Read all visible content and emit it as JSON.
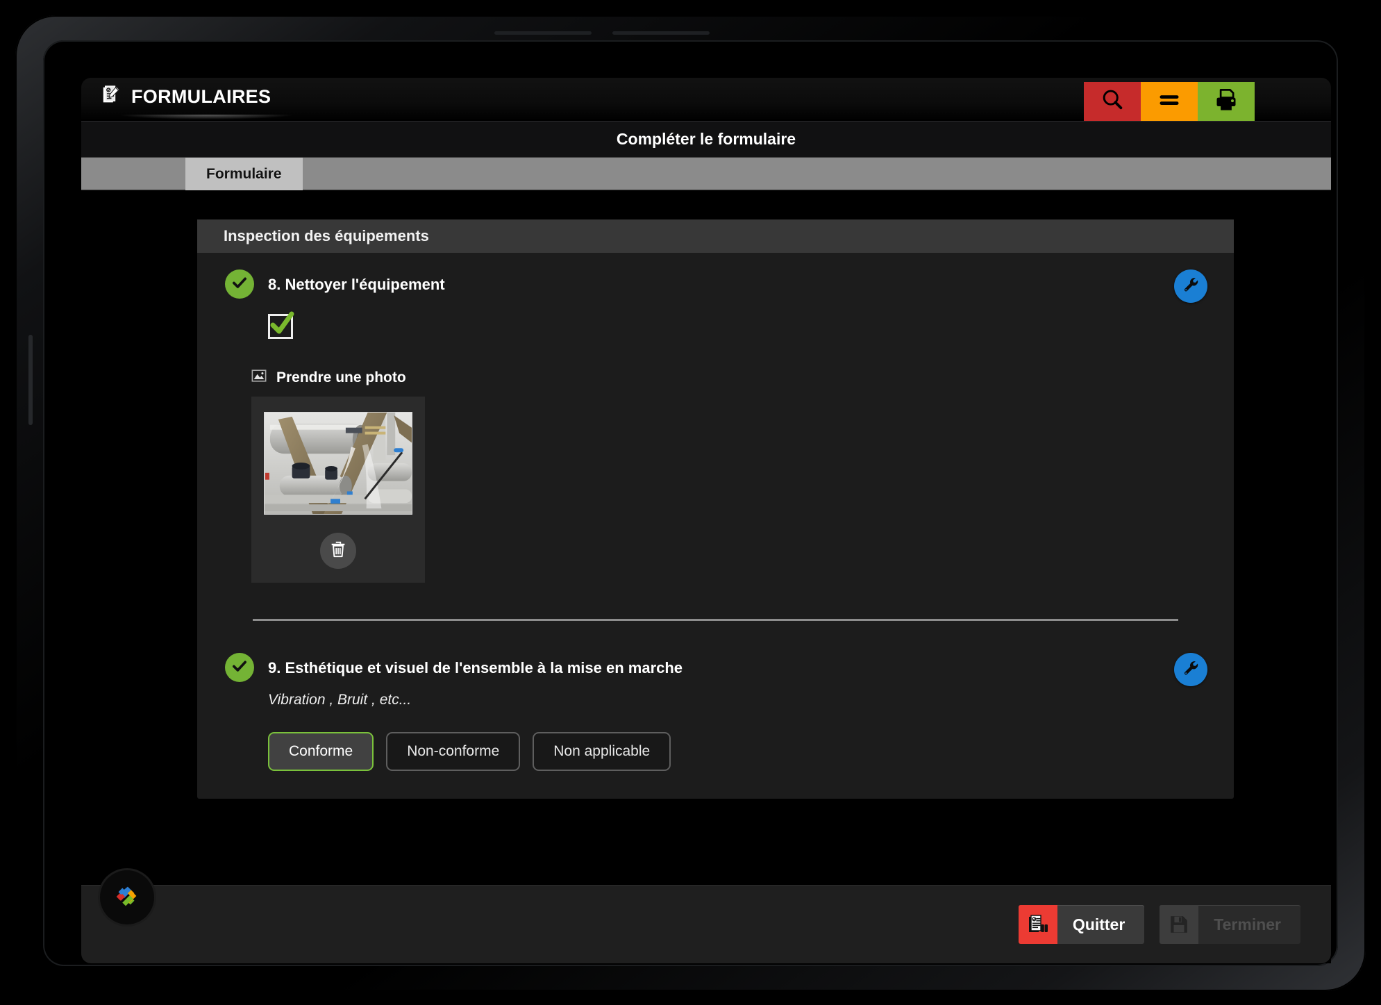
{
  "app": {
    "title": "FORMULAIRES",
    "title_icon": "form-clipboard-icon"
  },
  "header_actions": [
    {
      "name": "search-button",
      "icon": "search-icon",
      "color": "#c62b2b"
    },
    {
      "name": "menu-button",
      "icon": "menu-icon",
      "color": "#fb9b00"
    },
    {
      "name": "print-button",
      "icon": "printer-icon",
      "color": "#7cb32e"
    }
  ],
  "page": {
    "title": "Compléter le formulaire"
  },
  "tabs": [
    {
      "label": "Formulaire",
      "active": true
    }
  ],
  "section": {
    "title": "Inspection des équipements"
  },
  "questions": [
    {
      "id": "q8",
      "number": "8.",
      "title": "8. Nettoyer l'équipement",
      "subtitle": "",
      "status_icon": "check-circle-icon",
      "edit_icon": "wrench-icon",
      "control": "checkbox",
      "checkbox_checked": true,
      "photo_field": {
        "label": "Prendre une photo",
        "label_icon": "image-icon",
        "has_photo": true,
        "delete_icon": "trash-icon"
      }
    },
    {
      "id": "q9",
      "number": "9.",
      "title": "9. Esthétique et visuel de l'ensemble à la mise en marche",
      "subtitle": "Vibration , Bruit , etc...",
      "status_icon": "check-circle-icon",
      "edit_icon": "wrench-icon",
      "control": "choices",
      "choices": [
        {
          "label": "Conforme",
          "selected": true
        },
        {
          "label": "Non-conforme",
          "selected": false
        },
        {
          "label": "Non applicable",
          "selected": false
        }
      ]
    }
  ],
  "bottom_bar": {
    "logo_icon": "app-logo-icon",
    "quit": {
      "label": "Quitter",
      "icon": "document-exit-icon",
      "enabled": true,
      "icon_color": "#ec3b33"
    },
    "finish": {
      "label": "Terminer",
      "icon": "save-floppy-icon",
      "enabled": false
    }
  },
  "colors": {
    "accent_green": "#74b335",
    "accent_blue": "#1a7fd4",
    "accent_red": "#ec3b33",
    "accent_orange": "#fb9b00",
    "panel": "#1c1c1c",
    "section_header": "#383838"
  }
}
